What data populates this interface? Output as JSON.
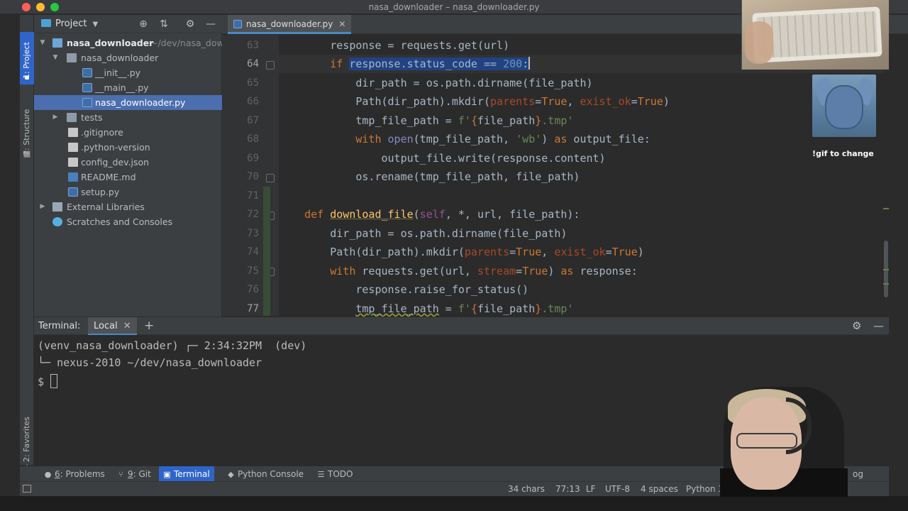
{
  "window": {
    "title": "nasa_downloader – nasa_downloader.py"
  },
  "left_strip": {
    "project_tab": "1: Project",
    "structure_tab": "7: Structure",
    "favorites_tab": "2: Favorites"
  },
  "project_panel": {
    "title": "Project",
    "tree": [
      {
        "label": "nasa_downloader",
        "path": "~/dev/nasa_dow",
        "type": "folder",
        "indent": 0,
        "expanded": true
      },
      {
        "label": "nasa_downloader",
        "type": "package",
        "indent": 1,
        "expanded": true
      },
      {
        "label": "__init__.py",
        "type": "py",
        "indent": 2
      },
      {
        "label": "__main__.py",
        "type": "py",
        "indent": 2
      },
      {
        "label": "nasa_downloader.py",
        "type": "py",
        "indent": 2,
        "selected": true
      },
      {
        "label": "tests",
        "type": "folder",
        "indent": 1,
        "expanded": false
      },
      {
        "label": ".gitignore",
        "type": "txt",
        "indent": 1
      },
      {
        "label": ".python-version",
        "type": "txt",
        "indent": 1
      },
      {
        "label": "config_dev.json",
        "type": "json",
        "indent": 1
      },
      {
        "label": "README.md",
        "type": "md",
        "indent": 1
      },
      {
        "label": "setup.py",
        "type": "py",
        "indent": 1
      },
      {
        "label": "External Libraries",
        "type": "libs",
        "indent": 0,
        "expanded": false
      },
      {
        "label": "Scratches and Consoles",
        "type": "scratch",
        "indent": 0
      }
    ]
  },
  "editor": {
    "tab_label": "nasa_downloader.py",
    "lines": [
      {
        "num": "63",
        "text": "        response = requests.get(url)"
      },
      {
        "num": "64",
        "text": "        if response.status_code == 200:"
      },
      {
        "num": "65",
        "text": "            dir_path = os.path.dirname(file_path)"
      },
      {
        "num": "66",
        "text": "            Path(dir_path).mkdir(parents=True, exist_ok=True)"
      },
      {
        "num": "67",
        "text": "            tmp_file_path = f'{file_path}.tmp'"
      },
      {
        "num": "68",
        "text": "            with open(tmp_file_path, 'wb') as output_file:"
      },
      {
        "num": "69",
        "text": "                output_file.write(response.content)"
      },
      {
        "num": "70",
        "text": "            os.rename(tmp_file_path, file_path)"
      },
      {
        "num": "71",
        "text": ""
      },
      {
        "num": "72",
        "text": "    def download_file(self, *, url, file_path):"
      },
      {
        "num": "73",
        "text": "        dir_path = os.path.dirname(file_path)"
      },
      {
        "num": "74",
        "text": "        Path(dir_path).mkdir(parents=True, exist_ok=True)"
      },
      {
        "num": "75",
        "text": "        with requests.get(url, stream=True) as response:"
      },
      {
        "num": "76",
        "text": "            response.raise_for_status()"
      },
      {
        "num": "77",
        "text": "            tmp_file_path = f'{file_path}.tmp'"
      }
    ]
  },
  "terminal": {
    "label": "Terminal:",
    "tab": "Local",
    "prompt_line1_env": "(venv_nasa_downloader)",
    "prompt_line1_time": "┌─ 2:34:32PM",
    "prompt_line1_branch": "(dev)",
    "prompt_line2": "└─ nexus-2010 ~/dev/nasa_downloader",
    "prompt_symbol": "$"
  },
  "bottom_tabs": [
    {
      "key": "6",
      "label": ": Problems",
      "icon": "info-icon"
    },
    {
      "key": "9",
      "label": ": Git",
      "icon": "git-icon"
    },
    {
      "key": "",
      "label": "Terminal",
      "icon": "terminal-icon",
      "active": true
    },
    {
      "key": "",
      "label": "Python Console",
      "icon": "python-icon"
    },
    {
      "key": "",
      "label": "TODO",
      "icon": "list-icon"
    }
  ],
  "bottom_right_partial": "og",
  "statusbar": {
    "chars": "34 chars",
    "position": "77:13",
    "line_sep": "LF",
    "encoding": "UTF-8",
    "indent": "4 spaces",
    "interpreter": "Python 3.9"
  },
  "overlay": {
    "gif_caption": "!gif to change"
  }
}
